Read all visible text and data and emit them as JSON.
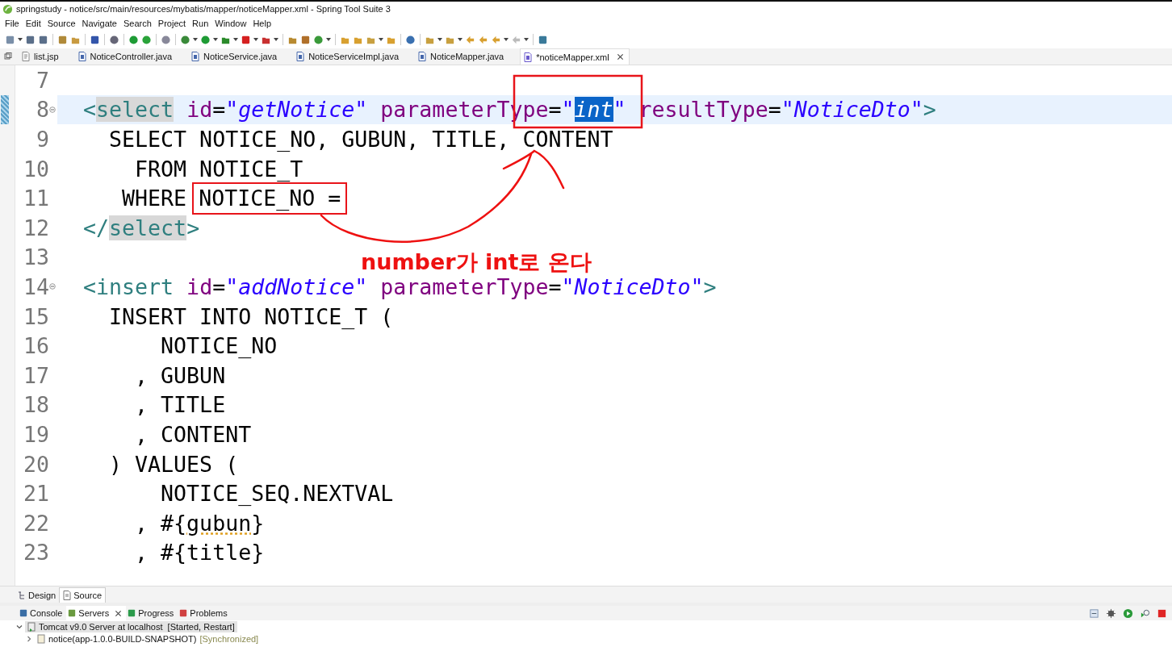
{
  "window": {
    "title": "springstudy - notice/src/main/resources/mybatis/mapper/noticeMapper.xml - Spring Tool Suite 3"
  },
  "menu": [
    "File",
    "Edit",
    "Source",
    "Navigate",
    "Search",
    "Project",
    "Run",
    "Window",
    "Help"
  ],
  "editor_tabs": [
    {
      "label": "list.jsp",
      "kind": "jsp",
      "selected": false
    },
    {
      "label": "NoticeController.java",
      "kind": "java",
      "selected": false
    },
    {
      "label": "NoticeService.java",
      "kind": "java",
      "selected": false
    },
    {
      "label": "NoticeServiceImpl.java",
      "kind": "java",
      "selected": false
    },
    {
      "label": "NoticeMapper.java",
      "kind": "java",
      "selected": false
    },
    {
      "label": "*noticeMapper.xml",
      "kind": "xml",
      "selected": true
    }
  ],
  "lines": [
    {
      "number": "7",
      "current": false,
      "foldable": false
    },
    {
      "number": "8",
      "current": true,
      "foldable": true,
      "tokens": [
        {
          "text": "  <",
          "kind": "tag"
        },
        {
          "text": "select",
          "kind": "name"
        },
        {
          "text": " id",
          "kind": "attr"
        },
        {
          "text": "=",
          "kind": "code"
        },
        {
          "text": "\"getNotice\"",
          "kind": "string"
        },
        {
          "text": " parameterType",
          "kind": "attr"
        },
        {
          "text": "=",
          "kind": "code"
        },
        {
          "text": "\"",
          "kind": "string"
        },
        {
          "text": "int",
          "kind": "selected"
        },
        {
          "text": "\"",
          "kind": "string"
        },
        {
          "text": " resultType",
          "kind": "attr"
        },
        {
          "text": "=",
          "kind": "code"
        },
        {
          "text": "\"NoticeDto\"",
          "kind": "string"
        },
        {
          "text": ">",
          "kind": "tag"
        }
      ]
    },
    {
      "number": "9",
      "current": false,
      "foldable": false,
      "tokens": [
        {
          "text": "    SELECT NOTICE_NO, GUBUN, TITLE, CONTENT",
          "kind": "code"
        }
      ]
    },
    {
      "number": "10",
      "current": false,
      "foldable": false,
      "tokens": [
        {
          "text": "      FROM NOTICE_T",
          "kind": "code"
        }
      ]
    },
    {
      "number": "11",
      "current": false,
      "foldable": false,
      "tokens": [
        {
          "text": "     WHERE ",
          "kind": "code"
        },
        {
          "text": "NOTICE_NO =",
          "kind": "boxed"
        }
      ]
    },
    {
      "number": "12",
      "current": false,
      "foldable": false,
      "tokens": [
        {
          "text": "  </",
          "kind": "tag"
        },
        {
          "text": "select",
          "kind": "name"
        },
        {
          "text": ">",
          "kind": "tag"
        }
      ]
    },
    {
      "number": "13",
      "current": false,
      "foldable": false
    },
    {
      "number": "14",
      "current": false,
      "foldable": true,
      "tokens": [
        {
          "text": "  <insert",
          "kind": "tag"
        },
        {
          "text": " id",
          "kind": "attr"
        },
        {
          "text": "=",
          "kind": "code"
        },
        {
          "text": "\"addNotice\"",
          "kind": "string"
        },
        {
          "text": " parameterType",
          "kind": "attr"
        },
        {
          "text": "=",
          "kind": "code"
        },
        {
          "text": "\"NoticeDto\"",
          "kind": "string"
        },
        {
          "text": ">",
          "kind": "tag"
        }
      ]
    },
    {
      "number": "15",
      "current": false,
      "foldable": false,
      "tokens": [
        {
          "text": "    INSERT INTO NOTICE_T (",
          "kind": "code"
        }
      ]
    },
    {
      "number": "16",
      "current": false,
      "foldable": false,
      "tokens": [
        {
          "text": "        NOTICE_NO",
          "kind": "code"
        }
      ]
    },
    {
      "number": "17",
      "current": false,
      "foldable": false,
      "tokens": [
        {
          "text": "      , GUBUN",
          "kind": "code"
        }
      ]
    },
    {
      "number": "18",
      "current": false,
      "foldable": false,
      "tokens": [
        {
          "text": "      , TITLE",
          "kind": "code"
        }
      ]
    },
    {
      "number": "19",
      "current": false,
      "foldable": false,
      "tokens": [
        {
          "text": "      , CONTENT",
          "kind": "code"
        }
      ]
    },
    {
      "number": "20",
      "current": false,
      "foldable": false,
      "tokens": [
        {
          "text": "    ) VALUES (",
          "kind": "code"
        }
      ]
    },
    {
      "number": "21",
      "current": false,
      "foldable": false,
      "tokens": [
        {
          "text": "        NOTICE_SEQ.NEXTVAL",
          "kind": "code"
        }
      ]
    },
    {
      "number": "22",
      "current": false,
      "foldable": false,
      "tokens": [
        {
          "text": "      , #{",
          "kind": "code"
        },
        {
          "text": "gubun",
          "kind": "misspelled"
        },
        {
          "text": "}",
          "kind": "code"
        }
      ]
    },
    {
      "number": "23",
      "current": false,
      "foldable": false,
      "tokens": [
        {
          "text": "      , #{title}",
          "kind": "code"
        }
      ]
    }
  ],
  "annotation": {
    "text": "number가 int로 온다"
  },
  "view_tabs": [
    {
      "label": "Design",
      "kind": "design",
      "selected": false
    },
    {
      "label": "Source",
      "kind": "source",
      "selected": true
    }
  ],
  "panel_tabs": [
    {
      "label": "Console",
      "kind": "console",
      "selected": false
    },
    {
      "label": "Servers",
      "kind": "servers",
      "selected": true
    },
    {
      "label": "Progress",
      "kind": "progress",
      "selected": false
    },
    {
      "label": "Problems",
      "kind": "problems",
      "selected": false
    }
  ],
  "servers": [
    {
      "label": "Tomcat v9.0 Server at localhost",
      "status": "[Started, Restart]",
      "expanded": true,
      "selected": true,
      "children": [
        {
          "label": "notice(app-1.0.0-BUILD-SNAPSHOT)",
          "status": "[Synchronized]",
          "expanded": false,
          "selected": false
        }
      ]
    }
  ]
}
